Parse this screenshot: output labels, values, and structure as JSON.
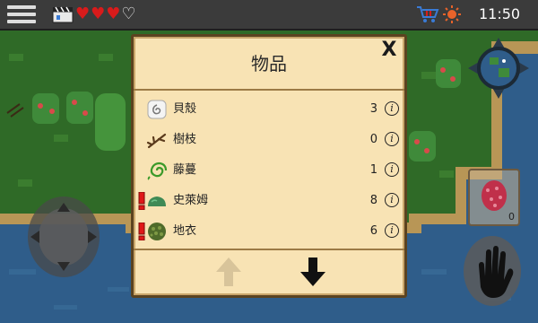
{
  "clock": "11:50",
  "hearts": {
    "full": 3,
    "empty": 1
  },
  "dialog": {
    "title": "物品",
    "close_label": "X",
    "items": [
      {
        "name": "貝殼",
        "qty": "3",
        "icon": "shell-icon",
        "warning": false
      },
      {
        "name": "樹枝",
        "qty": "0",
        "icon": "stick-icon",
        "warning": false
      },
      {
        "name": "藤蔓",
        "qty": "1",
        "icon": "vine-icon",
        "warning": false
      },
      {
        "name": "史萊姆",
        "qty": "8",
        "icon": "slime-icon",
        "warning": true
      },
      {
        "name": "地衣",
        "qty": "6",
        "icon": "lichen-icon",
        "warning": true
      }
    ],
    "info_label": "i"
  },
  "side_slot": {
    "count": "0",
    "icon": "berry-icon"
  },
  "colors": {
    "panel": "#f8e3b4",
    "border": "#5b4320",
    "heart": "#d81b1b",
    "warning": "#e01818"
  }
}
